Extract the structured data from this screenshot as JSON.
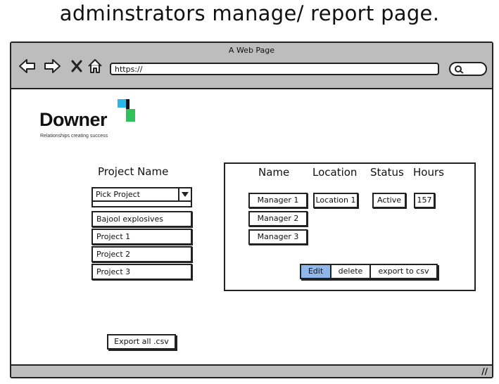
{
  "page_heading": "adminstrators manage/ report  page.",
  "window": {
    "title": "A Web Page",
    "url": "https://",
    "nav_icons": [
      "back-arrow-icon",
      "forward-arrow-icon",
      "close-x-icon",
      "home-icon"
    ],
    "search_icon": "search-icon"
  },
  "logo": {
    "word": "Downer",
    "tagline": "Relationships creating success",
    "colors": {
      "cyan": "#29b6e8",
      "green": "#2fc25b",
      "dark": "#111111"
    }
  },
  "project_panel": {
    "heading": "Project Name",
    "dropdown": {
      "selected": "Pick Project"
    },
    "projects": [
      "Bajool explosives",
      "Project 1",
      "Project 2",
      "Project 3"
    ],
    "export_all_label": "Export all .csv"
  },
  "results": {
    "columns": [
      "Name",
      "Location",
      "Status",
      "Hours"
    ],
    "names": [
      "Manager 1",
      "Manager 2",
      "Manager 3"
    ],
    "location": "Location 1",
    "status": "Active",
    "hours": "157",
    "actions": {
      "edit": "Edit",
      "delete": "delete",
      "export": "export to csv"
    },
    "active_action_color": "#8fb7ea"
  }
}
